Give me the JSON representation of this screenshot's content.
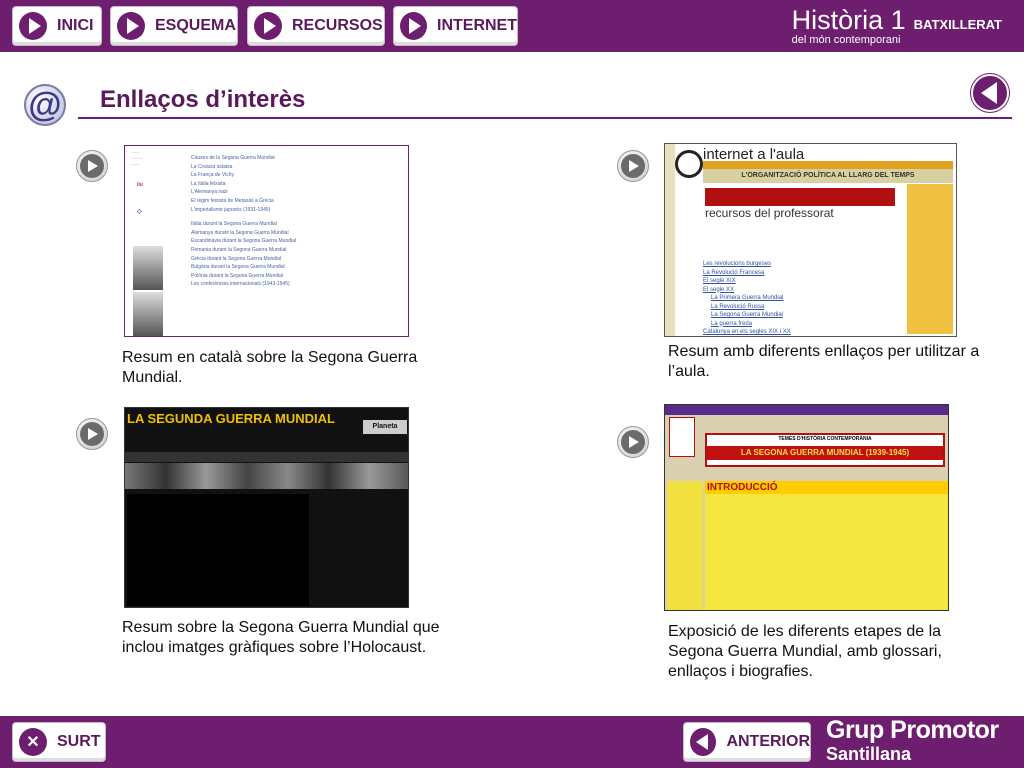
{
  "nav": {
    "inici": "INICI",
    "esquema": "ESQUEMA",
    "recursos": "RECURSOS",
    "internet": "INTERNET"
  },
  "brand": {
    "title": "Història 1",
    "level": "BATXILLERAT",
    "subtitle": "del món contemporani"
  },
  "page": {
    "title": "Enllaços d’interès"
  },
  "links": [
    {
      "description": "Resum en català sobre la Segona Guerra Mundial."
    },
    {
      "description": "Resum amb diferents enllaços per utilitzar a l’aula.",
      "thumb_header": "internet a l'aula",
      "thumb_band": "L'ORGANITZACIÓ POLÍTICA AL LLARG DEL TEMPS",
      "thumb_brand": "recursos del professorat"
    },
    {
      "description": "Resum sobre la Segona Guerra Mundial que inclou imatges gràfiques sobre l’Holocaust.",
      "thumb_title": "LA SEGUNDA GUERRA MUNDIAL",
      "thumb_tag": "Planeta Sedna"
    },
    {
      "description": "Exposició de les diferents etapes de la Segona Guerra Mundial, amb glossari, enllaços i biografies.",
      "thumb_banner_top": "TEMES D'HISTÒRIA CONTEMPORÀNIA",
      "thumb_banner": "LA SEGONA GUERRA MUNDIAL (1939-1945)",
      "thumb_intro": "INTRODUCCIÓ"
    }
  ],
  "thumb1_items": [
    "Causes de la Segona Guerra Mundial",
    "La Croàcia ústaixa",
    "La França de Vichy",
    "La Itàlia feixista",
    "L'Alemanya nazi",
    "El règim feixista de Metaxàs a Grècia",
    "L'imperialisme japonès (1931-1945)",
    "Itàlia durant la Segona Guerra Mundial",
    "Alemanya durant la Segona Guerra Mundial",
    "Escandinàvia durant la Segona Guerra Mundial",
    "Romania durant la Segona Guerra Mundial",
    "Grècia durant la Segona Guerra Mundial",
    "Bulgària durant la Segona Guerra Mundial",
    "Polònia durant la Segona Guerra Mundial",
    "Les conferències internacionals (1943-1945)"
  ],
  "thumb2_links": [
    "Les revolucions burgeses",
    "La Revolució Francesa",
    "El segle XIX",
    "El segle XX",
    "La Primera Guerra Mundial",
    "La Revolució Russa",
    "La Segona Guerra Mundial",
    "La guerra freda",
    "Catalunya en els segles XIX i XX"
  ],
  "bottom": {
    "exit": "SURT",
    "previous": "ANTERIOR",
    "publisher_1": "Grup Promotor",
    "publisher_2": "Santillana"
  },
  "colors": {
    "primary": "#6e1e6e",
    "button_bg": "#ffffff",
    "text": "#111111"
  }
}
